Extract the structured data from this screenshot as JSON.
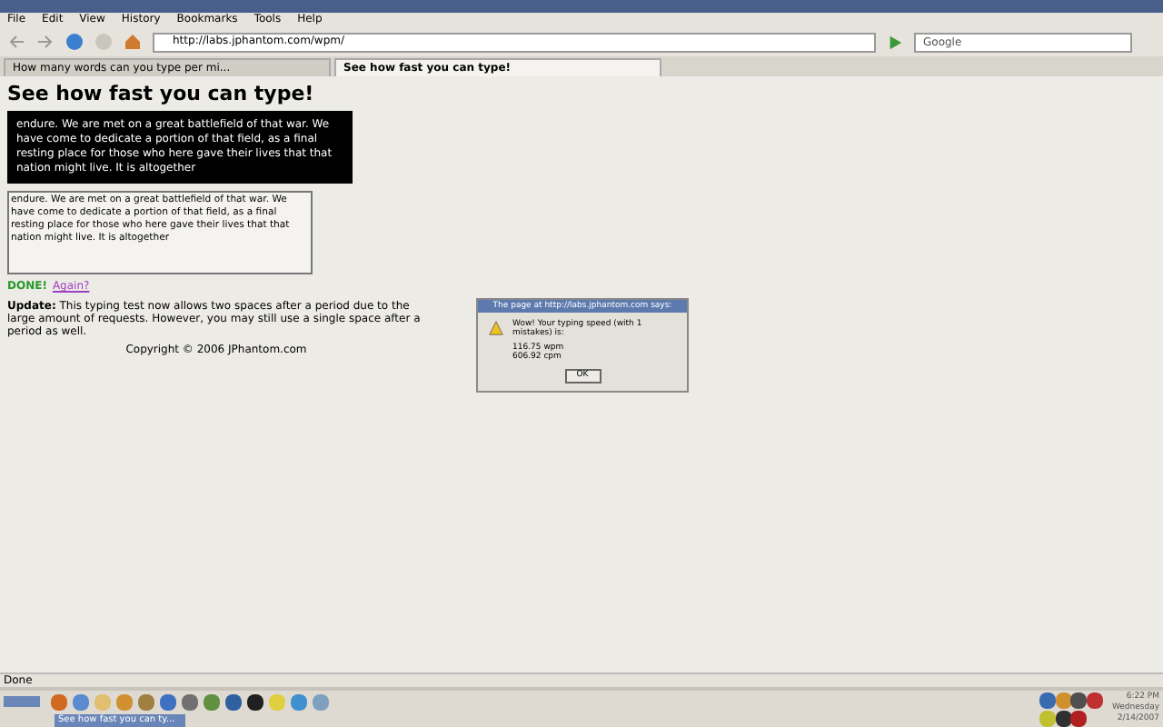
{
  "menu": [
    "File",
    "Edit",
    "View",
    "History",
    "Bookmarks",
    "Tools",
    "Help"
  ],
  "address": {
    "value": "http://labs.jphantom.com/wpm/"
  },
  "search": {
    "placeholder": "Google"
  },
  "tabs": [
    {
      "label": "How many words can you type per mi...",
      "selected": false
    },
    {
      "label": "See how fast you can type!",
      "selected": true
    }
  ],
  "page": {
    "heading": "See how fast you can type!",
    "sample_text": "endure. We are met on a great battlefield of that war. We have come to dedicate a portion of that field, as a final resting place for those who here gave their lives that that nation might live. It is altogether",
    "typed_text": "endure. We are met on a great battlefield of that war. We have come to dedicate a portion of that field, as a final resting place for those who here gave their lives that that nation might live. It is altogether",
    "done": "DONE!",
    "again_link": "Again?",
    "update": "**Update:** This typing test now allows two spaces after a period due to the large amount of requests. However, you may still use a single space after a period as well.",
    "copyright": "Copyright © 2006 JPhantom.com"
  },
  "dialog": {
    "title": "The page at http://labs.jphantom.com says:",
    "message": "Wow! Your typing speed (with 1 mistakes) is:",
    "lines": [
      "116.75 wpm",
      "606.92 cpm"
    ],
    "button": "OK"
  },
  "status_bar": "Done",
  "taskbar": {
    "window": "See how fast you can ty...",
    "clock": [
      "6:22 PM",
      "Wednesday",
      "2/14/2007"
    ]
  }
}
